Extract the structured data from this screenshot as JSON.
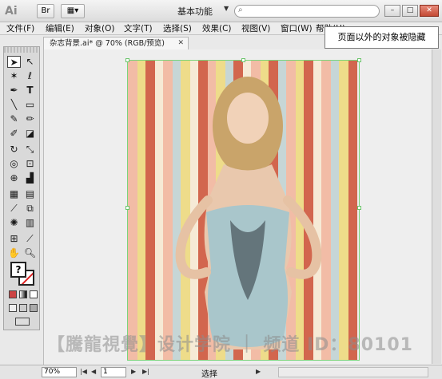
{
  "app": {
    "logo": "Ai",
    "workspace": "基本功能",
    "search_placeholder": ""
  },
  "menu": [
    "文件(F)",
    "编辑(E)",
    "对象(O)",
    "文字(T)",
    "选择(S)",
    "效果(C)",
    "视图(V)",
    "窗口(W)",
    "帮助(H)"
  ],
  "document": {
    "tab_title": "杂志背景.ai* @ 70% (RGB/预览)"
  },
  "tooltip": {
    "text": "页面以外的对象被隐藏"
  },
  "watermark": {
    "text": "【騰龍視覺】设计学院 ｜ 频道 ID：80101"
  },
  "status": {
    "zoom": "70%",
    "page": "1",
    "status_text": "选择"
  },
  "colors": {
    "stripe_red": "#d2664e",
    "stripe_pink": "#f2bca6",
    "stripe_yellow": "#eedc8a",
    "stripe_blue": "#c6d6d6",
    "stripe_cream": "#f6ead6",
    "selection": "#7bd47b"
  },
  "icons": {
    "selection": "selection-tool-icon",
    "direct_selection": "direct-selection-tool-icon",
    "magic_wand": "magic-wand-icon",
    "lasso": "lasso-icon",
    "pen": "pen-icon",
    "type": "type-icon",
    "line": "line-icon",
    "rectangle": "rectangle-icon",
    "brush": "paintbrush-icon",
    "pencil": "pencil-icon",
    "blob": "blob-brush-icon",
    "eraser": "eraser-icon",
    "rotate": "rotate-icon",
    "scale": "scale-icon",
    "warp": "warp-icon",
    "free_transform": "free-transform-icon",
    "shape_builder": "shape-builder-icon",
    "perspective": "perspective-grid-icon",
    "mesh": "mesh-icon",
    "gradient": "gradient-icon",
    "eyedropper": "eyedropper-icon",
    "blend": "blend-icon",
    "symbol_sprayer": "symbol-sprayer-icon",
    "graph": "column-graph-icon",
    "artboard": "artboard-icon",
    "slice": "slice-icon",
    "hand": "hand-icon",
    "zoom": "zoom-icon"
  }
}
